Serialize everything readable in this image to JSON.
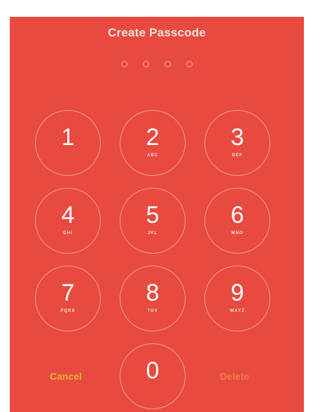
{
  "header": {
    "title": "Create Passcode"
  },
  "passcode": {
    "length": 4,
    "filled": 0
  },
  "keypad": {
    "keys": [
      {
        "digit": "1",
        "letters": ""
      },
      {
        "digit": "2",
        "letters": "ABC"
      },
      {
        "digit": "3",
        "letters": "DEF"
      },
      {
        "digit": "4",
        "letters": "GHI"
      },
      {
        "digit": "5",
        "letters": "JKL"
      },
      {
        "digit": "6",
        "letters": "MNO"
      },
      {
        "digit": "7",
        "letters": "PQRS"
      },
      {
        "digit": "8",
        "letters": "TUV"
      },
      {
        "digit": "9",
        "letters": "WXYZ"
      },
      {
        "digit": "0",
        "letters": ""
      }
    ]
  },
  "actions": {
    "cancel_label": "Cancel",
    "delete_label": "Delete"
  },
  "colors": {
    "background": "#e84a3f",
    "cancel": "#f2b12e",
    "delete": "#ee7a4c"
  }
}
